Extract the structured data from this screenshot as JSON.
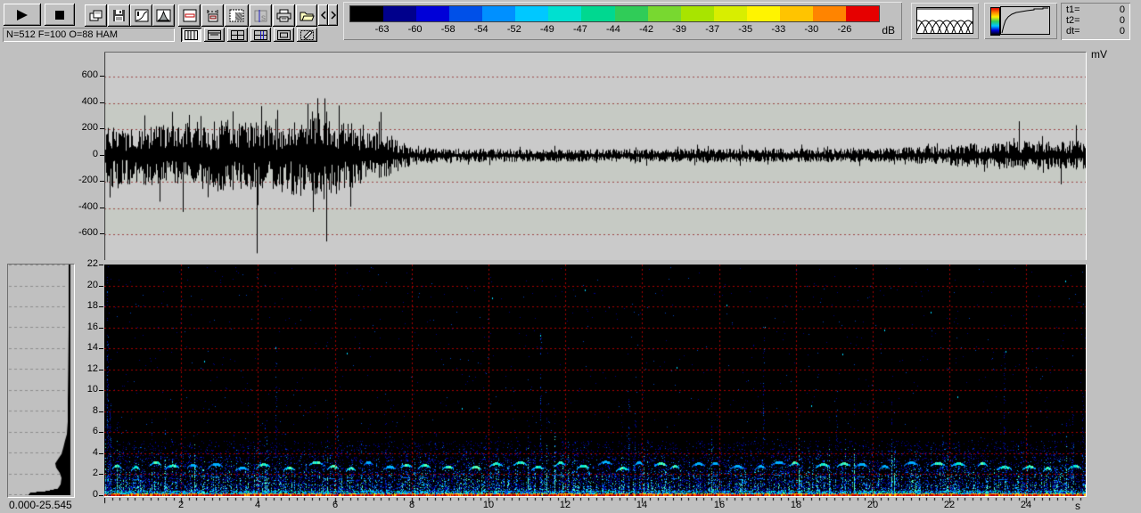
{
  "toolbar": {
    "status_text": "N=512 F=100 O=88 HAM"
  },
  "colorbar": {
    "tick_labels": [
      "-63",
      "-60",
      "-58",
      "-54",
      "-52",
      "-49",
      "-47",
      "-44",
      "-42",
      "-39",
      "-37",
      "-35",
      "-33",
      "-30",
      "-26"
    ],
    "unit": "dB",
    "colors": [
      "#000000",
      "#00008c",
      "#0000d8",
      "#0050e8",
      "#0090ff",
      "#00c8ff",
      "#00e0d0",
      "#00d890",
      "#30cc58",
      "#78d830",
      "#a8e400",
      "#d8ee00",
      "#fff400",
      "#ffc400",
      "#ff8400",
      "#e60000"
    ]
  },
  "time_panel": {
    "rows": [
      {
        "label": "t1=",
        "value": "0"
      },
      {
        "label": "t2=",
        "value": "0"
      },
      {
        "label": "dt=",
        "value": "0"
      }
    ]
  },
  "waveform_axis": {
    "unit": "mV"
  },
  "spectrogram_axis": {
    "xunit": "s"
  },
  "histogram": {
    "caption": "0.000-25.545"
  },
  "chart_data": [
    {
      "type": "line",
      "title": "waveform",
      "ylabel": "mV",
      "xlim": [
        0,
        25.545
      ],
      "ylim": [
        -780,
        780
      ],
      "yticks": [
        600,
        400,
        200,
        0,
        -200,
        -400,
        -600
      ],
      "grid": "red-dotted-horizontal",
      "envelope_mV": [
        [
          0,
          230
        ],
        [
          0.5,
          185
        ],
        [
          2,
          205
        ],
        [
          3,
          235
        ],
        [
          4,
          215
        ],
        [
          5,
          260
        ],
        [
          5.7,
          300
        ],
        [
          6.5,
          205
        ],
        [
          7.5,
          125
        ],
        [
          8,
          62
        ],
        [
          9,
          45
        ],
        [
          12,
          40
        ],
        [
          16,
          46
        ],
        [
          20,
          45
        ],
        [
          21.5,
          58
        ],
        [
          22.5,
          80
        ],
        [
          23.5,
          92
        ],
        [
          25.5,
          96
        ]
      ],
      "spikes_mV": [
        [
          0.15,
          -320
        ],
        [
          1.05,
          305
        ],
        [
          2.05,
          -430
        ],
        [
          2.5,
          300
        ],
        [
          3.35,
          335
        ],
        [
          3.97,
          -745
        ],
        [
          4.5,
          345
        ],
        [
          5.3,
          395
        ],
        [
          5.55,
          435
        ],
        [
          5.78,
          -655
        ],
        [
          6.1,
          380
        ],
        [
          6.4,
          -390
        ],
        [
          7.2,
          330
        ],
        [
          23.8,
          260
        ],
        [
          24.9,
          -220
        ],
        [
          25.3,
          230
        ]
      ]
    },
    {
      "type": "heatmap",
      "title": "spectrogram",
      "xlim": [
        0,
        25.545
      ],
      "ylim_kHz": [
        0,
        22
      ],
      "yticks": [
        22,
        20,
        18,
        16,
        14,
        12,
        10,
        8,
        6,
        4,
        2,
        0
      ],
      "xticks": [
        2,
        4,
        6,
        8,
        10,
        12,
        14,
        16,
        18,
        20,
        22,
        24
      ],
      "xunit": "s",
      "grid": "red-dotted",
      "noise_band_kHz": [
        0,
        5.2
      ],
      "chirp_band_kHz": [
        2.3,
        3.2
      ],
      "chirp_period_s": 0.55,
      "bottom_band_kHz": [
        0,
        0.5
      ],
      "streaks": [
        [
          0.06,
          22,
          1.6
        ],
        [
          0.14,
          9,
          2.2
        ],
        [
          4.45,
          14.2,
          0.8
        ],
        [
          6.05,
          8,
          1.0
        ],
        [
          7.3,
          7,
          0.9
        ],
        [
          8.6,
          6,
          0.8
        ],
        [
          9.9,
          6,
          0.7
        ],
        [
          11.35,
          15.5,
          0.8
        ],
        [
          13.65,
          9.2,
          1.2
        ],
        [
          13.8,
          8.5,
          1.0
        ],
        [
          17.15,
          16.2,
          0.7
        ],
        [
          19.05,
          10,
          0.8
        ],
        [
          21.8,
          7.5,
          0.8
        ],
        [
          23.4,
          14,
          0.9
        ],
        [
          25.2,
          8,
          1.1
        ],
        [
          25.45,
          10,
          1.3
        ]
      ],
      "specks": [
        [
          2.6,
          12.8
        ],
        [
          4.45,
          14.1
        ],
        [
          6.3,
          13.6
        ],
        [
          8.0,
          11.0
        ],
        [
          10.1,
          18.9
        ],
        [
          11.35,
          15.3
        ],
        [
          12.5,
          19.6
        ],
        [
          14.9,
          12.2
        ],
        [
          16.2,
          18.2
        ],
        [
          17.2,
          16.1
        ],
        [
          19.2,
          13.5
        ],
        [
          20.3,
          15.8
        ],
        [
          21.5,
          17.5
        ],
        [
          23.45,
          13.8
        ],
        [
          25.0,
          20.5
        ],
        [
          9.3,
          8.3
        ],
        [
          18.4,
          8.6
        ],
        [
          22.2,
          9.4
        ]
      ]
    },
    {
      "type": "area",
      "title": "average-spectrum-profile",
      "range_label": "0.000-25.545",
      "profile_kHz_width": [
        [
          0,
          46
        ],
        [
          0.2,
          44
        ],
        [
          0.35,
          26
        ],
        [
          0.6,
          13
        ],
        [
          1.0,
          10
        ],
        [
          1.6,
          9
        ],
        [
          2.1,
          11
        ],
        [
          2.6,
          15
        ],
        [
          3.0,
          16
        ],
        [
          3.4,
          13
        ],
        [
          3.9,
          9
        ],
        [
          4.5,
          7
        ],
        [
          5.2,
          5
        ],
        [
          5.8,
          3
        ],
        [
          7,
          2
        ],
        [
          9,
          2
        ],
        [
          12,
          1.5
        ],
        [
          16,
          1
        ],
        [
          20,
          1
        ],
        [
          22,
          1
        ]
      ]
    }
  ]
}
